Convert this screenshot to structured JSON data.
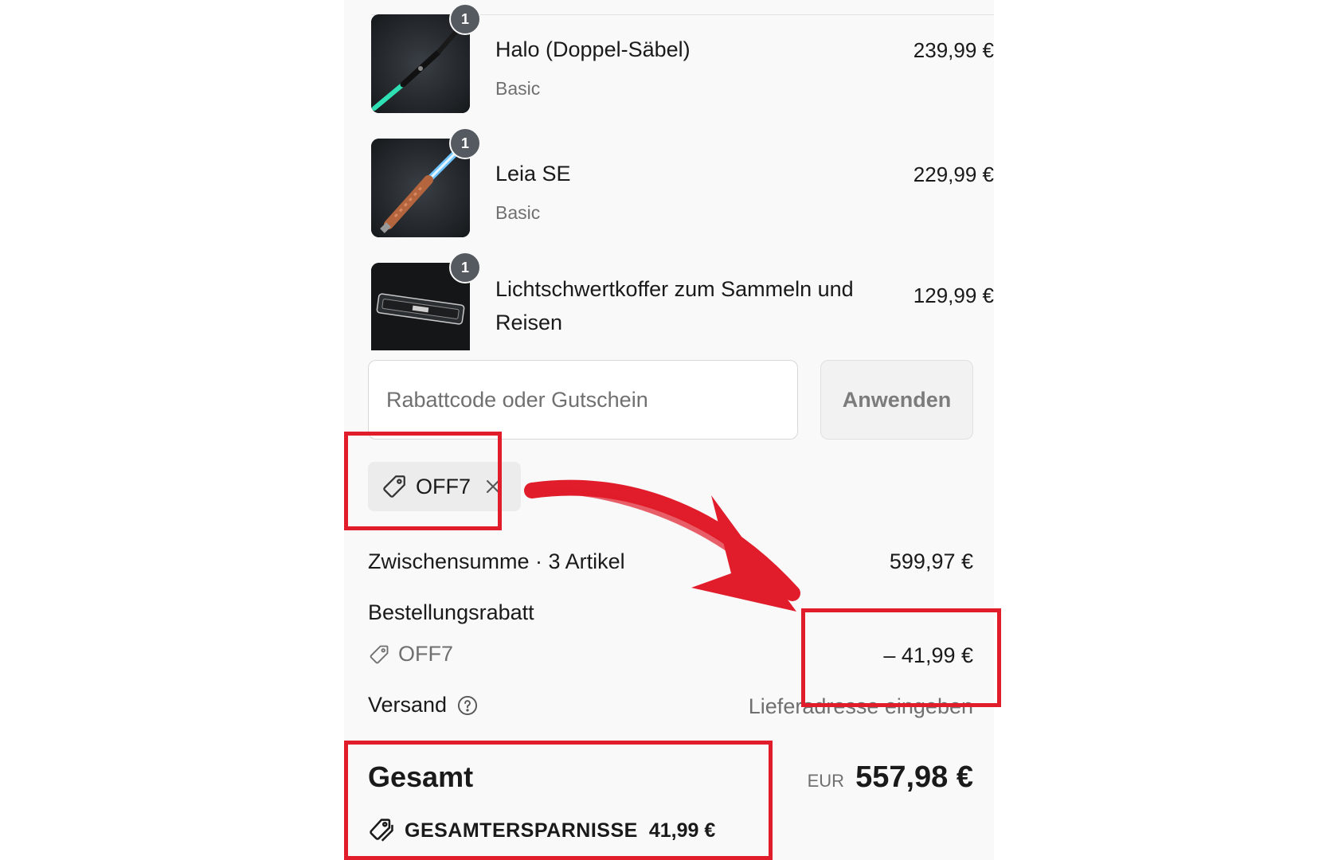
{
  "cart": {
    "items": [
      {
        "name": "Halo (Doppel-Säbel)",
        "variant": "Basic",
        "price": "239,99 €",
        "quantity": "1"
      },
      {
        "name": "Leia SE",
        "variant": "Basic",
        "price": "229,99 €",
        "quantity": "1"
      },
      {
        "name": "Lichtschwertkoffer zum Sammeln und Reisen",
        "variant": "",
        "price": "129,99 €",
        "quantity": "1"
      }
    ]
  },
  "discount": {
    "placeholder": "Rabattcode oder Gutschein",
    "apply_label": "Anwenden",
    "applied_code": "OFF7"
  },
  "summary": {
    "subtotal_label": "Zwischensumme · 3 Artikel",
    "subtotal_value": "599,97 €",
    "order_discount_label": "Bestellungsrabatt",
    "order_discount_code": "OFF7",
    "order_discount_value": "– 41,99 €",
    "shipping_label": "Versand",
    "shipping_value": "Lieferadresse eingeben",
    "total_label": "Gesamt",
    "total_currency": "EUR",
    "total_value": "557,98 €",
    "savings_label": "GESAMTERSPARNISSE",
    "savings_value": "41,99 €"
  },
  "icons": {
    "tag": "tag-icon",
    "close": "close-icon",
    "help": "help-circle-icon",
    "savings": "tags-icon"
  },
  "colors": {
    "annotation_red": "#e11d2b",
    "panel_bg": "#f9f9f9",
    "muted_text": "#707070"
  }
}
